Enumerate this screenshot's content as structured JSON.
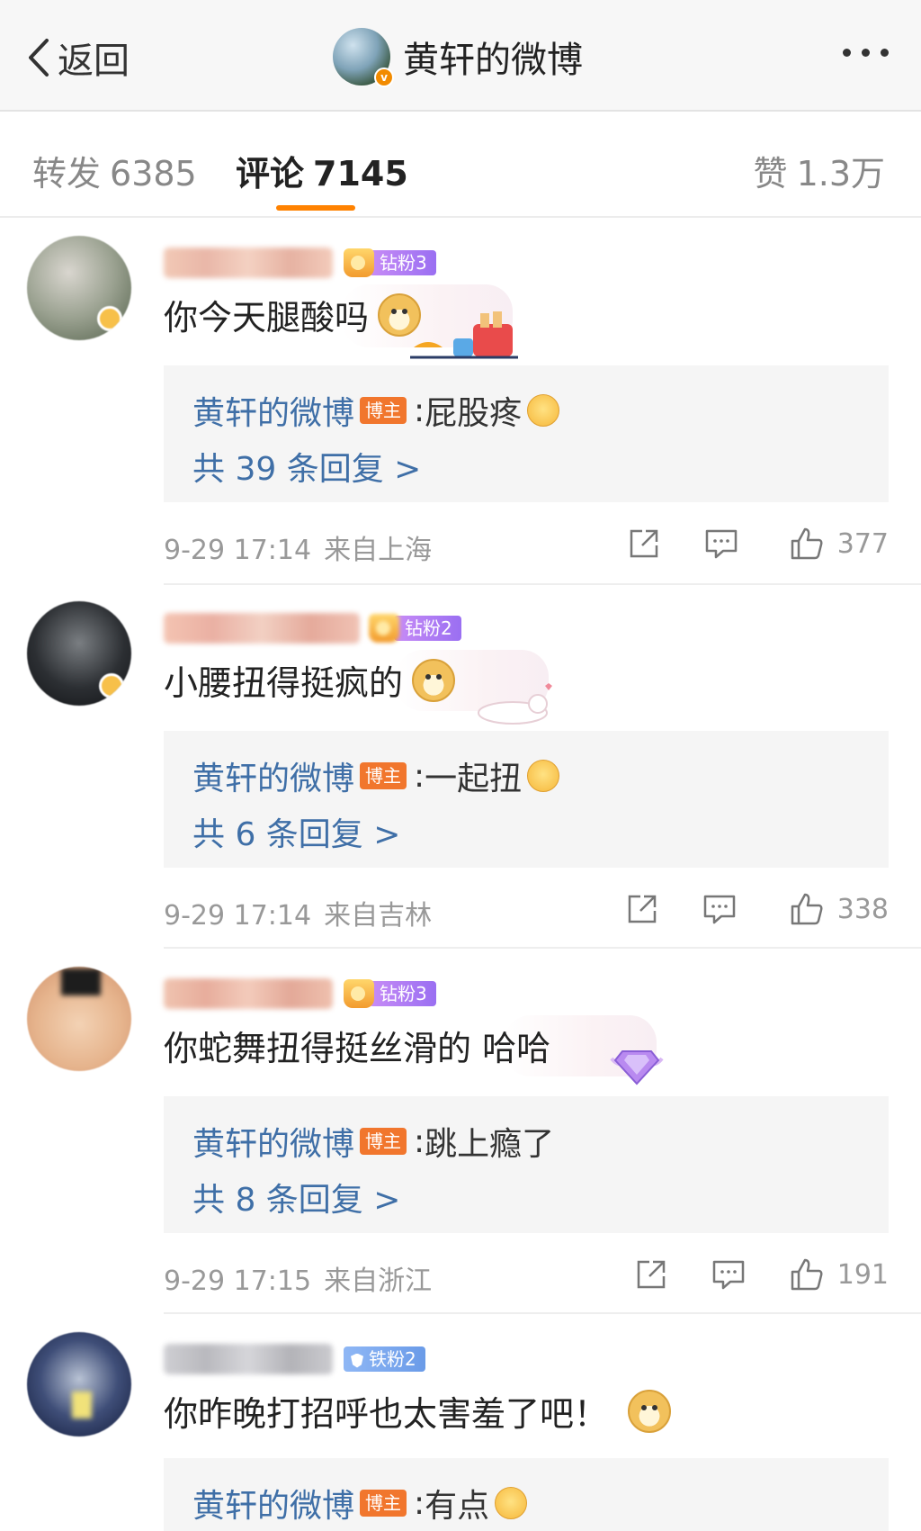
{
  "topbar": {
    "back_label": "返回",
    "title": "黄轩的微博"
  },
  "tabs": {
    "forward_label": "转发",
    "forward_count": "6385",
    "comment_label": "评论",
    "comment_count": "7145",
    "like_label": "赞",
    "like_count": "1.3万"
  },
  "colors": {
    "accent": "#ff8200",
    "link": "#3f6fa7",
    "host_tag": "#f1762d",
    "meta_text": "#999999"
  },
  "comments": [
    {
      "fan_badge": "钻粉3",
      "text": "你今天腿酸吗",
      "reply_author": "黄轩的微博",
      "host_tag": "博主",
      "reply_text": "屁股疼",
      "reply_count": "共 39 条回复 >",
      "time": "9-29 17:14",
      "location": "来自上海",
      "likes": "377"
    },
    {
      "fan_badge": "钻粉2",
      "text": "小腰扭得挺疯的",
      "reply_author": "黄轩的微博",
      "host_tag": "博主",
      "reply_text": "一起扭",
      "reply_count": "共 6 条回复 >",
      "time": "9-29 17:14",
      "location": "来自吉林",
      "likes": "338"
    },
    {
      "fan_badge": "钻粉3",
      "text": "你蛇舞扭得挺丝滑的  哈哈",
      "reply_author": "黄轩的微博",
      "host_tag": "博主",
      "reply_text": "跳上瘾了",
      "reply_count": "共 8 条回复 >",
      "time": "9-29 17:15",
      "location": "来自浙江",
      "likes": "191"
    },
    {
      "fan_badge": "铁粉2",
      "text": "你昨晚打招呼也太害羞了吧！",
      "reply_author": "黄轩的微博",
      "host_tag": "博主",
      "reply_text": "有点"
    }
  ]
}
